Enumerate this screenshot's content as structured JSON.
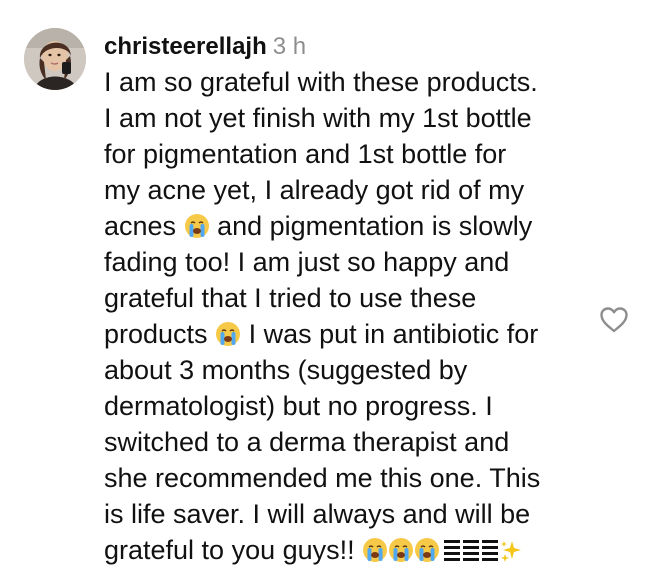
{
  "comment": {
    "username": "christeerellajh",
    "timestamp": "3 h",
    "lines": [
      "I am so grateful with these products.",
      "I am not yet finish with my 1st bottle",
      "for pigmentation and 1st bottle for",
      "my acne yet, I already got rid of my",
      "acnes",
      "and pigmentation is slowly",
      "fading too! I am just so happy and",
      "grateful that I tried to use these",
      "products",
      "I was put in antibiotic for",
      "about 3 months (suggested by",
      "dermatologist) but no progress. I",
      "switched to a derma therapist and",
      "she recommended me this one. This",
      "is life saver. I will always and will be",
      "grateful to you guys!!"
    ],
    "emoji_icons": [
      "loudly-crying-face",
      "black-bars",
      "sparkles"
    ],
    "like_icon": "heart-outline-icon"
  },
  "colors": {
    "text": "#111111",
    "timestamp": "#8e8e8e",
    "icon_stroke": "#8e8e8e",
    "emoji_face": "#f7c948"
  }
}
